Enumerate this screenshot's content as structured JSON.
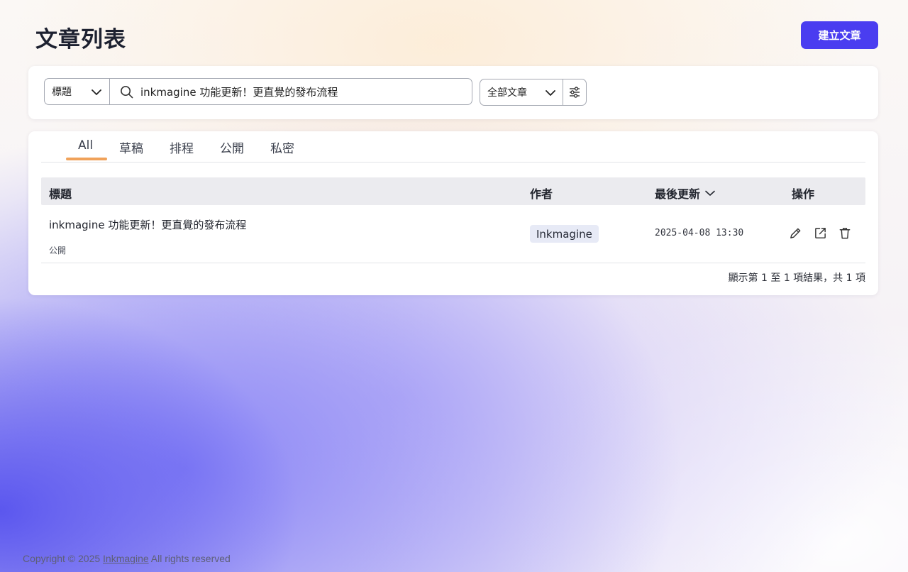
{
  "header": {
    "title": "文章列表",
    "create_label": "建立文章"
  },
  "filters": {
    "field_select": "標題",
    "search_value": "inkmagine 功能更新！更直覺的發布流程",
    "scope_select": "全部文章"
  },
  "tabs": [
    {
      "label": "All",
      "active": true
    },
    {
      "label": "草稿",
      "active": false
    },
    {
      "label": "排程",
      "active": false
    },
    {
      "label": "公開",
      "active": false
    },
    {
      "label": "私密",
      "active": false
    }
  ],
  "table": {
    "columns": {
      "title": "標題",
      "author": "作者",
      "updated": "最後更新",
      "actions": "操作"
    },
    "rows": [
      {
        "title": "inkmagine 功能更新！更直覺的發布流程",
        "status": "公開",
        "author": "Inkmagine",
        "updated": "2025-04-08 13:30"
      }
    ],
    "summary": "顯示第 1 至 1 項結果，共 1 項"
  },
  "footer": {
    "prefix": "Copyright © 2025 ",
    "brand": "Inkmagine",
    "suffix": " All rights reserved"
  },
  "colors": {
    "primary": "#4a3df0",
    "tab_indicator": "#f0a25a",
    "badge_bg": "#e7eaf6"
  },
  "icons": {
    "search": "search-icon",
    "select_chevron": "chevron-down-icon",
    "filter": "sliders-icon",
    "sort": "chevron-down-icon",
    "edit": "pencil-icon",
    "open": "external-link-icon",
    "delete": "trash-icon"
  }
}
